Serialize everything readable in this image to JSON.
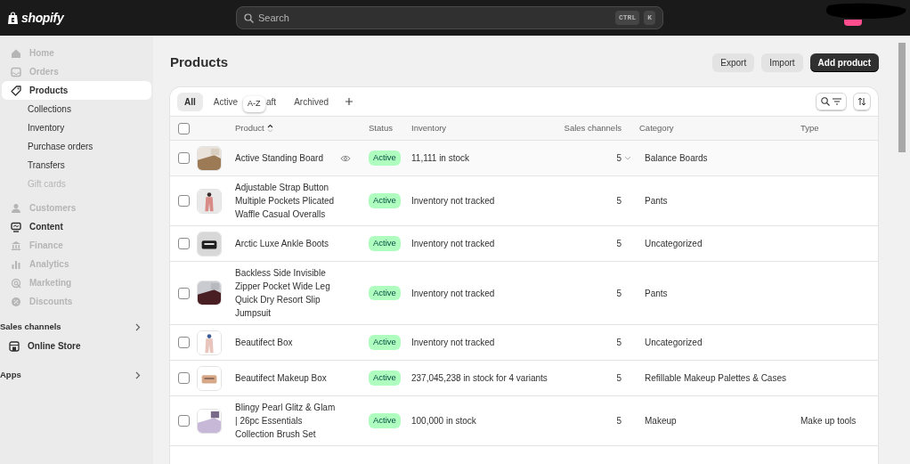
{
  "topbar": {
    "logo": "shopify",
    "search": {
      "placeholder": "Search",
      "shortcut": [
        "CTRL",
        "K"
      ]
    }
  },
  "sidebar": {
    "items": [
      {
        "label": "Home",
        "disabled": true,
        "selected": false
      },
      {
        "label": "Orders",
        "disabled": true,
        "selected": false
      },
      {
        "label": "Products",
        "disabled": false,
        "selected": true,
        "children": [
          {
            "label": "Collections",
            "disabled": false
          },
          {
            "label": "Inventory",
            "disabled": false
          },
          {
            "label": "Purchase orders",
            "disabled": false
          },
          {
            "label": "Transfers",
            "disabled": false
          },
          {
            "label": "Gift cards",
            "disabled": true
          }
        ]
      },
      {
        "label": "Customers",
        "disabled": true,
        "selected": false
      },
      {
        "label": "Content",
        "disabled": false,
        "selected": false
      },
      {
        "label": "Finance",
        "disabled": true,
        "selected": false
      },
      {
        "label": "Analytics",
        "disabled": true,
        "selected": false
      },
      {
        "label": "Marketing",
        "disabled": true,
        "selected": false
      },
      {
        "label": "Discounts",
        "disabled": true,
        "selected": false
      }
    ],
    "sections": [
      {
        "label": "Sales channels",
        "items": [
          {
            "label": "Online Store"
          }
        ]
      },
      {
        "label": "Apps"
      }
    ]
  },
  "page": {
    "title": "Products",
    "buttons": [
      {
        "label": "Export",
        "kind": "secondary"
      },
      {
        "label": "Import",
        "kind": "secondary"
      },
      {
        "label": "Add product",
        "kind": "primary"
      }
    ]
  },
  "tabs": [
    {
      "label": "All",
      "selected": true
    },
    {
      "label": "Active",
      "selected": false
    },
    {
      "label": "aft",
      "selected": false
    },
    {
      "label": "Archived",
      "selected": false
    }
  ],
  "tooltip": "A-Z",
  "table": {
    "columns": [
      "Product",
      "Status",
      "Inventory",
      "Sales channels",
      "Category",
      "Type"
    ],
    "header_checked": false,
    "rows": [
      {
        "checked": false,
        "hovered": true,
        "product": "Active Standing Board",
        "status": "Active",
        "inventory": "11,111 in stock",
        "channels": "5",
        "category": "Balance Boards"
      },
      {
        "checked": false,
        "hovered": false,
        "product": "Adjustable Strap Button Multiple Pockets Plicated Waffle Casual Overalls",
        "status": "Active",
        "inventory": "Inventory not tracked",
        "channels": "5",
        "category": "Pants"
      },
      {
        "checked": false,
        "hovered": false,
        "product": "Arctic Luxe Ankle Boots",
        "status": "Active",
        "inventory": "Inventory not tracked",
        "channels": "5",
        "category": "Uncategorized"
      },
      {
        "checked": false,
        "hovered": false,
        "product": "Backless Side Invisible Zipper Pocket Wide Leg Quick Dry Resort Slip Jumpsuit",
        "status": "Active",
        "inventory": "Inventory not tracked",
        "channels": "5",
        "category": "Pants"
      },
      {
        "checked": false,
        "hovered": false,
        "product": "Beautifect Box",
        "status": "Active",
        "inventory": "Inventory not tracked",
        "channels": "5",
        "category": "Uncategorized"
      },
      {
        "checked": false,
        "hovered": false,
        "product": "Beautifect Makeup Box",
        "status": "Active",
        "inventory": "237,045,238 in stock for 4 variants",
        "channels": "5",
        "category": "Refillable Makeup Palettes & Cases"
      },
      {
        "checked": false,
        "hovered": false,
        "product": "Blingy Pearl Glitz & Glam | 26pc Essentials Collection Brush Set",
        "status": "Active",
        "inventory": "100,000 in stock",
        "channels": "5",
        "category": "Makeup",
        "type": "Make up tools"
      }
    ]
  }
}
